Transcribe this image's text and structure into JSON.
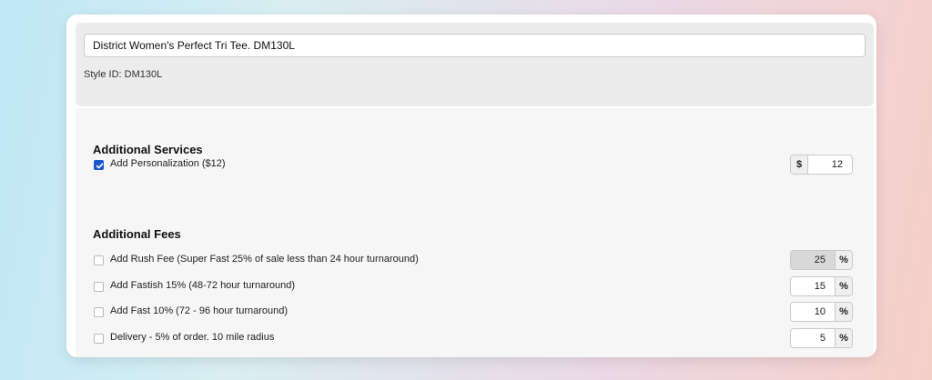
{
  "header": {
    "product_name": "District Women's Perfect Tri Tee. DM130L",
    "style_id": "Style ID: DM130L"
  },
  "additional_services": {
    "title": "Additional Services",
    "items": [
      {
        "label": "Add Personalization ($12)",
        "checked": true,
        "prefix": "$",
        "value": "12"
      }
    ]
  },
  "additional_fees": {
    "title": "Additional Fees",
    "items": [
      {
        "label": "Add Rush Fee (Super Fast 25% of sale less than 24 hour turnaround)",
        "checked": false,
        "value": "25",
        "suffix": "%",
        "disabled": true
      },
      {
        "label": "Add Fastish 15% (48-72 hour turnaround)",
        "checked": false,
        "value": "15",
        "suffix": "%"
      },
      {
        "label": "Add Fast 10% (72 - 96 hour turnaround)",
        "checked": false,
        "value": "10",
        "suffix": "%"
      },
      {
        "label": "Delivery - 5% of order. 10 mile radius",
        "checked": false,
        "value": "5",
        "suffix": "%"
      }
    ]
  },
  "colors": {
    "checkbox_checked": "#1a57c9",
    "panel_gray": "#ececec",
    "content_bg": "#f6f6f6"
  }
}
